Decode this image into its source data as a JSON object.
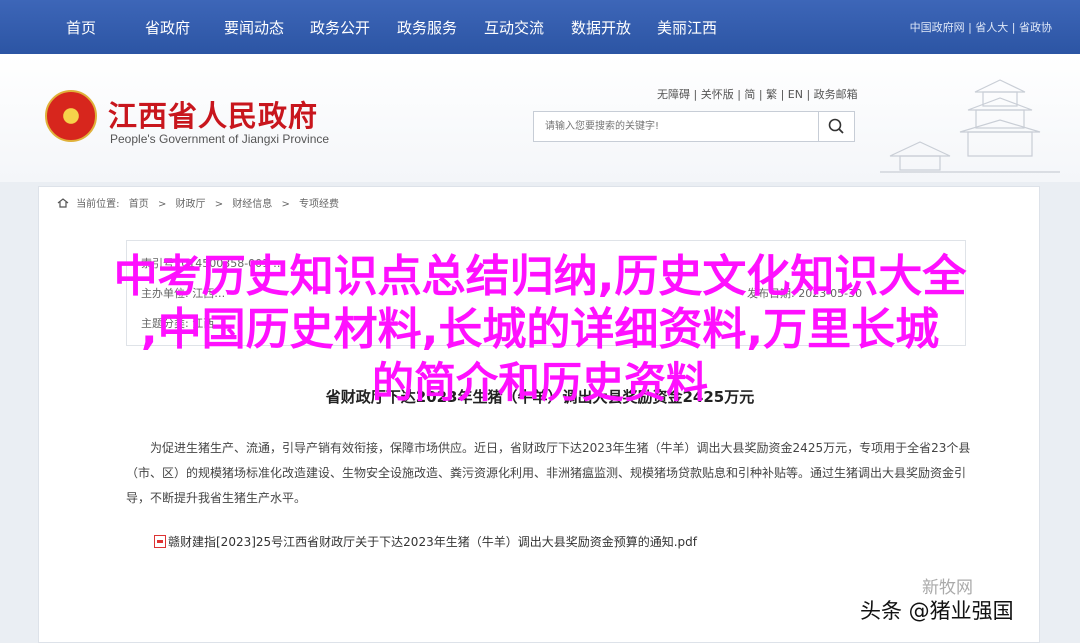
{
  "nav": {
    "items": [
      "首页",
      "省政府",
      "要闻动态",
      "政务公开",
      "政务服务",
      "互动交流",
      "数据开放",
      "美丽江西"
    ],
    "right_links": "中国政府网 | 省人大 | 省政协"
  },
  "header": {
    "site_name_cn": "江西省人民政府",
    "site_name_en": "People's Government of Jiangxi Province",
    "tool_links": "无障碍 | 关怀版 | 简 | 繁 | EN | 政务邮箱",
    "search_placeholder": "请输入您要搜索的关键字!"
  },
  "breadcrumb": {
    "label": "当前位置:",
    "items": [
      "首页",
      "财政厅",
      "财经信息",
      "专项经费"
    ]
  },
  "infobox": {
    "row1": "索引号: 014500358-001-…",
    "row2": "主办单位: 江西…",
    "row3": "发布日期: 2023-05-30",
    "row4": "主题分类: 江西…"
  },
  "document": {
    "title": "省财政厅下达2023年生猪（牛羊）调出大县奖励资金2425万元",
    "paragraph": "为促进生猪生产、流通，引导产销有效衔接，保障市场供应。近日，省财政厅下达2023年生猪（牛羊）调出大县奖励资金2425万元，专项用于全省23个县（市、区）的规模猪场标准化改造建设、生物安全设施改造、粪污资源化利用、非洲猪瘟监测、规模猪场贷款贴息和引种补贴等。通过生猪调出大县奖励资金引导，不断提升我省生猪生产水平。",
    "attachment": "赣财建指[2023]25号江西省财政厅关于下达2023年生猪（牛羊）调出大县奖励资金预算的通知.pdf"
  },
  "overlay": {
    "line1": "中考历史知识点总结归纳,历史文化知识大全",
    "line2": ",中国历史材料,长城的详细资料,万里长城",
    "line3": "的简介和历史资料"
  },
  "watermark": "新牧网",
  "signature": "头条 @猪业强国",
  "colors": {
    "nav_bg": "#2f58a8",
    "site_title": "#c8161d",
    "overlay_text": "#ff10ff"
  }
}
